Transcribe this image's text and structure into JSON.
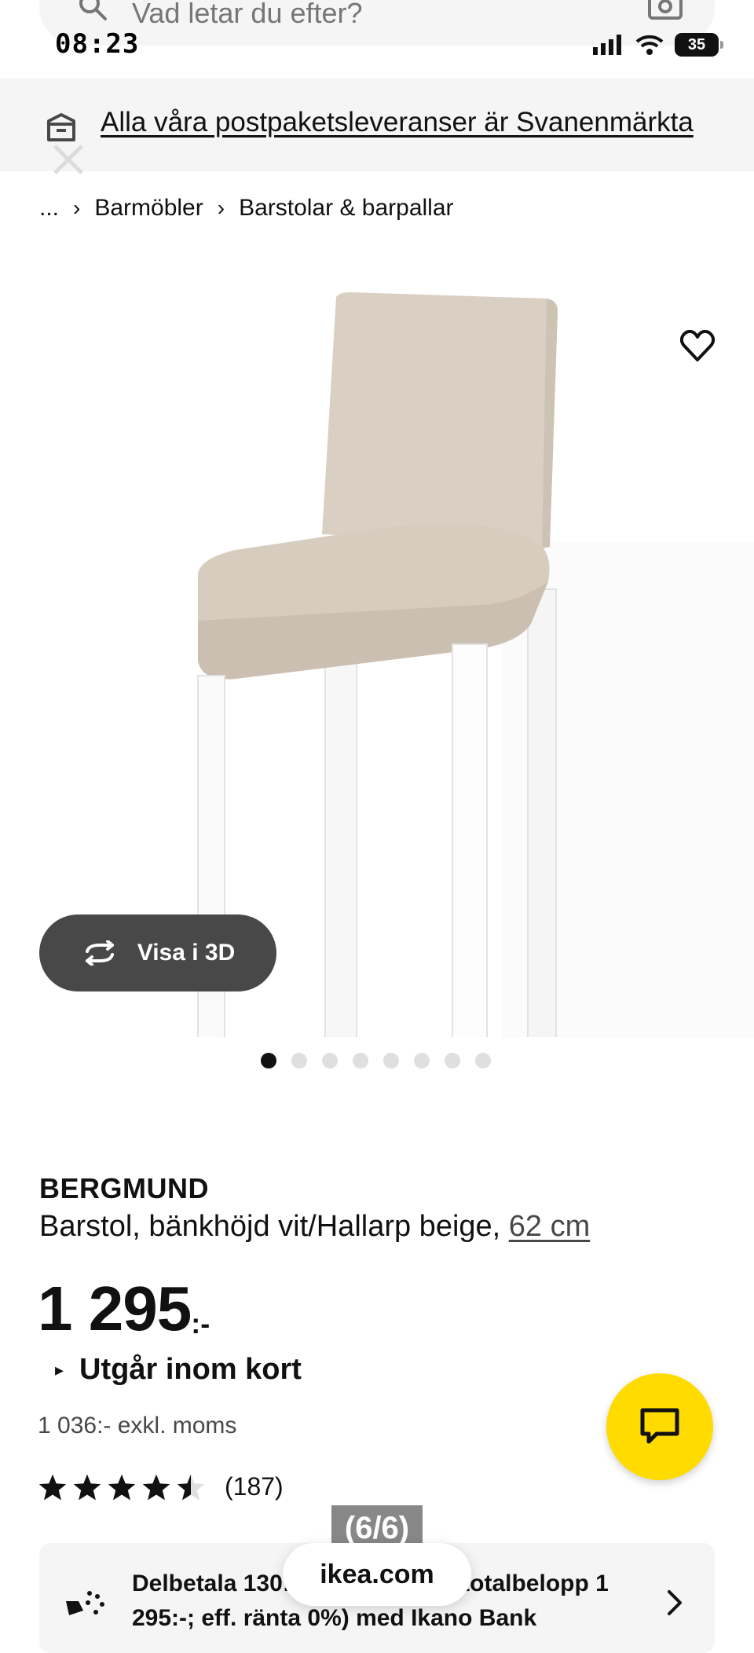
{
  "status_bar": {
    "time": "08:23",
    "battery": "35"
  },
  "search": {
    "placeholder": "Vad letar du efter?"
  },
  "banner": {
    "text": "Alla våra postpaketsleveranser är Svanenmärkta"
  },
  "breadcrumb": {
    "ellipsis": "...",
    "items": [
      "Barmöbler",
      "Barstolar & barpallar"
    ]
  },
  "gallery": {
    "view_3d_label": "Visa i 3D",
    "image_count": 8,
    "active_index": 0
  },
  "product": {
    "brand": "BERGMUND",
    "description": "Barstol, bänkhöjd vit/Hallarp beige,",
    "size_link": "62 cm",
    "price": "1 295",
    "price_suffix": ":-",
    "availability": "Utgår inom kort",
    "price_excl_vat": "1 036:- exkl. moms",
    "rating_value": 4.5,
    "rating_count": "(187)"
  },
  "financing": {
    "text": "Delbetala 130:-/mån (24 mån, totalbelopp 1 295:-; eff. ränta 0%) med Ikano Bank"
  },
  "overlays": {
    "page_counter": "(6/6)",
    "url": "ikea.com"
  },
  "colors": {
    "accent_yellow": "#ffdb00",
    "dark_button": "#484848",
    "background_grey": "#f5f5f5"
  },
  "icons": [
    "search-icon",
    "camera-icon",
    "box-icon",
    "close-icon",
    "heart-icon",
    "rotate-3d-icon",
    "star-icon",
    "chat-icon",
    "finance-icon",
    "chevron-right-icon"
  ]
}
